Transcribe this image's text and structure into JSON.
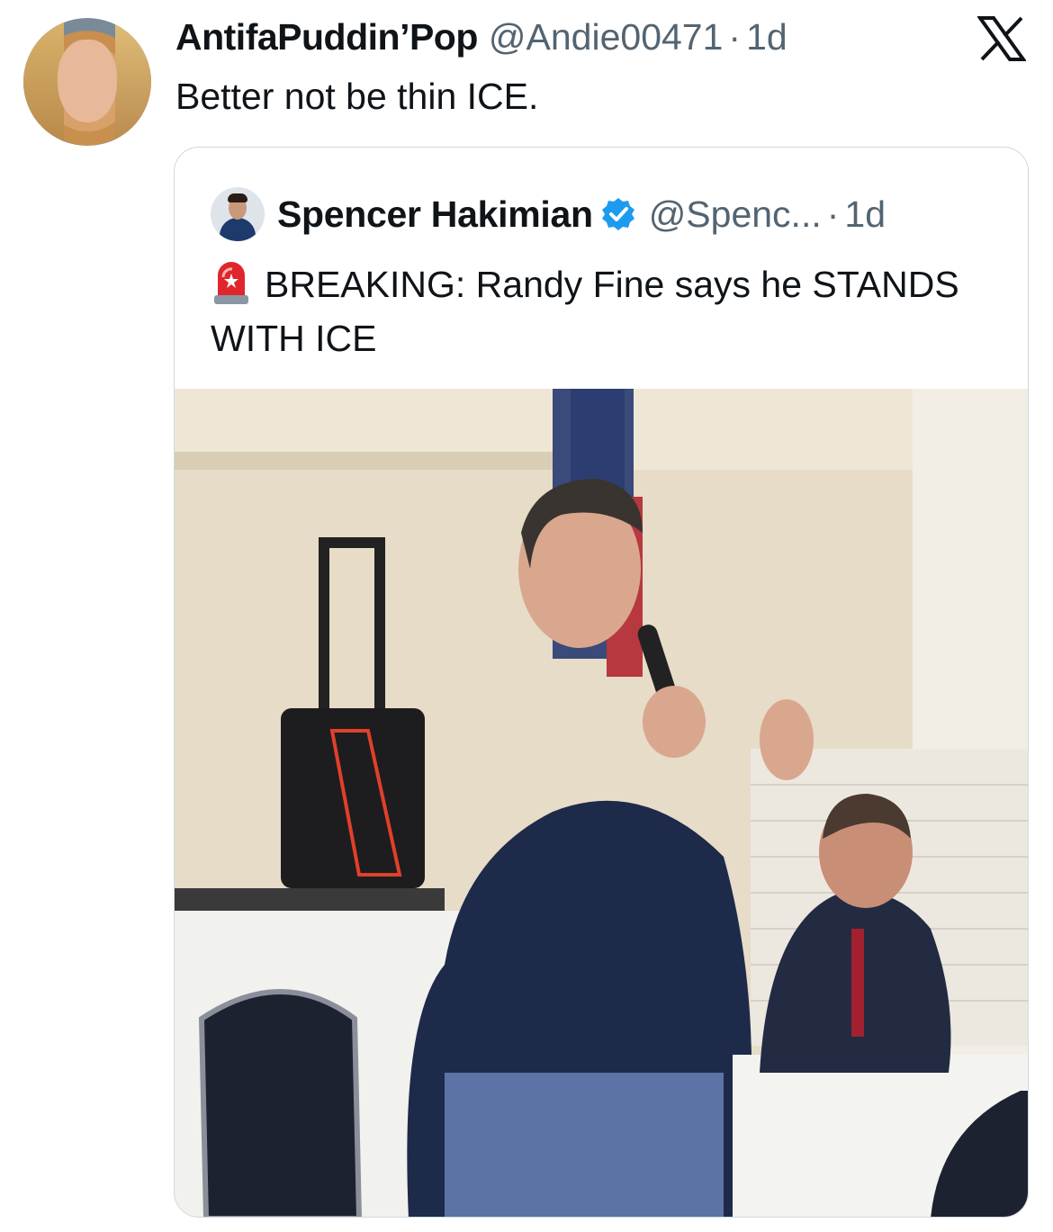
{
  "tweet": {
    "author_name": "AntifaPuddin’Pop",
    "handle": "@Andie00471",
    "separator": "·",
    "time": "1d",
    "text": "Better not be thin ICE.",
    "avatar_icon": "profile-avatar",
    "platform_icon": "x-logo-icon"
  },
  "quoted": {
    "author_name": "Spencer Hakimian",
    "verified_icon": "verified-badge-icon",
    "verified_color": "#1d9bf0",
    "handle": "@Spenc...",
    "separator": "·",
    "time": "1d",
    "emoji_icon": "police-siren-icon",
    "text": "BREAKING: Randy Fine says he STANDS WITH ICE",
    "image": "photo of a man in a navy t-shirt speaking into a microphone at an event"
  },
  "colors": {
    "text": "#0f1419",
    "secondary": "#536471",
    "border": "#cfd9de"
  }
}
